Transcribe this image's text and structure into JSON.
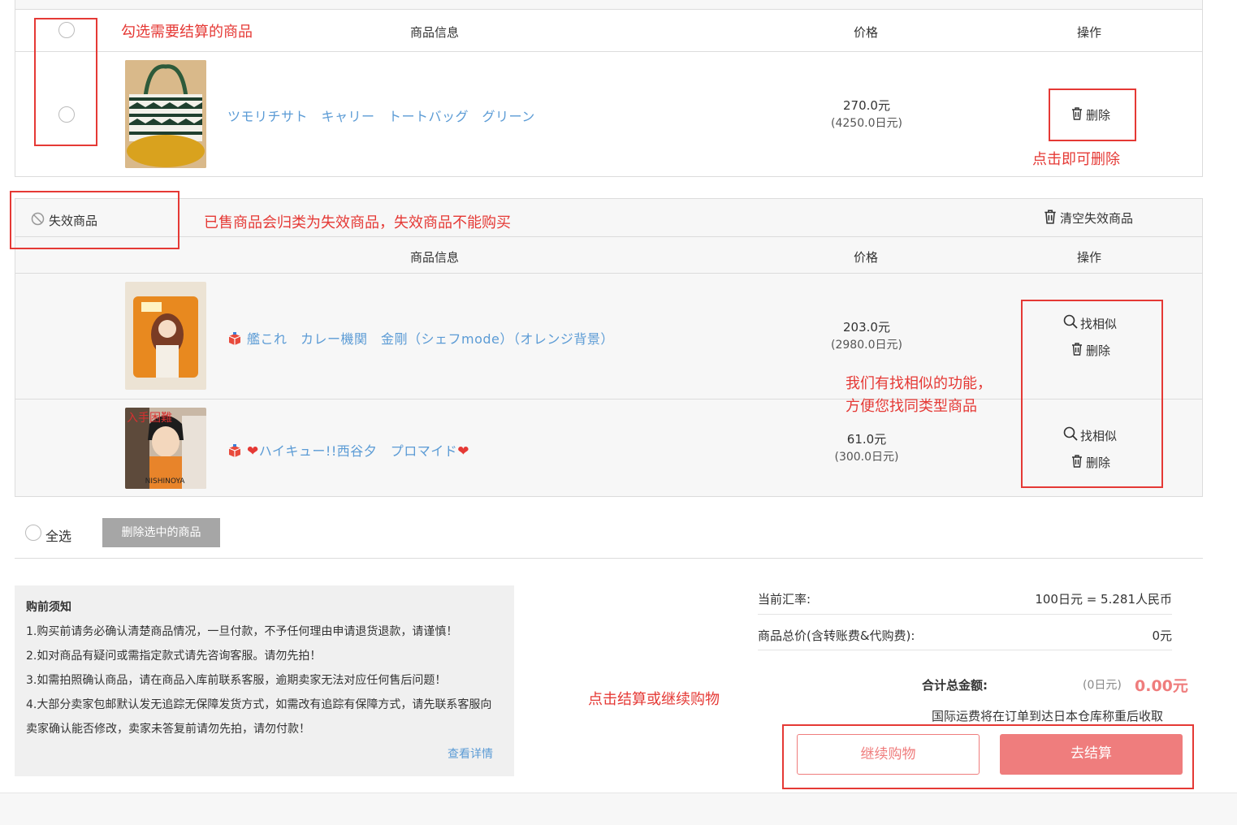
{
  "table_header": {
    "info": "商品信息",
    "price": "价格",
    "op": "操作"
  },
  "valid_items": [
    {
      "title": "ツモリチサト　キャリー　トートバッグ　グリーン",
      "price_cny": "270.0元",
      "price_jpy": "(4250.0日元)",
      "delete": "删除"
    }
  ],
  "invalid_section": {
    "label": "失效商品",
    "clear": "清空失效商品"
  },
  "invalid_items": [
    {
      "title": "艦これ　カレー機関　金剛（シェフmode）（オレンジ背景）",
      "price_cny": "203.0元",
      "price_jpy": "(2980.0日元)",
      "similar": "找相似",
      "delete": "删除"
    },
    {
      "title": "ハイキュー!!西谷夕　プロマイド",
      "price_cny": "61.0元",
      "price_jpy": "(300.0日元)",
      "similar": "找相似",
      "delete": "删除",
      "thumb_text": "入手困難"
    }
  ],
  "footer": {
    "select_all": "全选",
    "delete_selected": "删除选中的商品"
  },
  "notice": {
    "title": "购前须知",
    "lines": [
      "1.购买前请务必确认清楚商品情况，一旦付款，不予任何理由申请退货退款，请谨慎！",
      "2.如对商品有疑问或需指定款式请先咨询客服。请勿先拍！",
      "3.如需拍照确认商品，请在商品入库前联系客服，逾期卖家无法对应任何售后问题！",
      "4.大部分卖家包邮默认发无追踪无保障发货方式，如需改有追踪有保障方式，请先联系客服向卖家确认能否修改，卖家未答复前请勿先拍，请勿付款！"
    ],
    "more": "查看详情"
  },
  "summary": {
    "rate_label": "当前汇率:",
    "rate_value": "100日元 = 5.281人民币",
    "total_label": "商品总价(含转账费&代购费):",
    "total_value": "0元",
    "grand_label": "合计总金额:",
    "grand_jpy": "(0日元)",
    "grand_cny": "0.00元",
    "shipping_note": "国际运费将在订单到达日本仓库称重后收取",
    "continue": "继续购物",
    "checkout": "去结算"
  },
  "annotations": {
    "select": "勾选需要结算的商品",
    "delete": "点击即可删除",
    "invalid": "已售商品会归类为失效商品，失效商品不能购买",
    "similar_1": "我们有找相似的功能，",
    "similar_2": "方便您找同类型商品",
    "checkout": "点击结算或继续购物"
  },
  "colors": {
    "accent": "#ef7d7d",
    "annotation": "#e53935",
    "link": "#5b9bd5"
  }
}
